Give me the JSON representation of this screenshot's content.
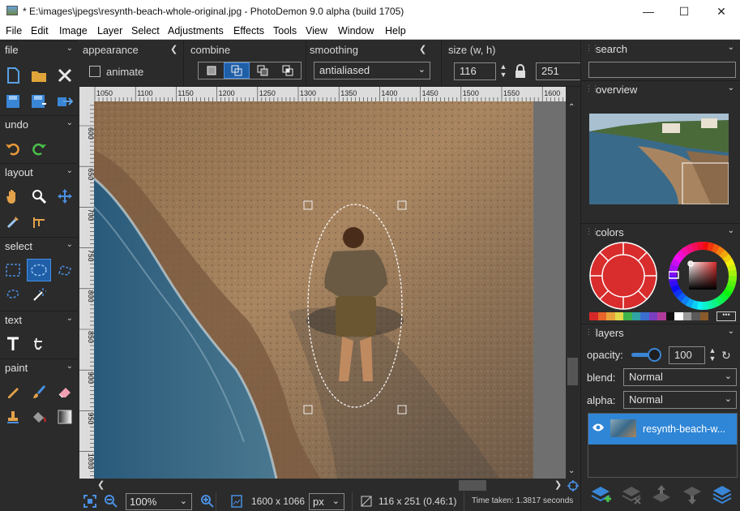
{
  "window": {
    "title": "* E:\\images\\jpegs\\resynth-beach-whole-original.jpg  -  PhotoDemon 9.0 alpha (build 1705)",
    "controls": [
      "minimize",
      "maximize",
      "close"
    ]
  },
  "menu": [
    "File",
    "Edit",
    "Image",
    "Layer",
    "Select",
    "Adjustments",
    "Effects",
    "Tools",
    "View",
    "Window",
    "Help"
  ],
  "toolbox": {
    "sections": {
      "file": "file",
      "undo": "undo",
      "layout": "layout",
      "select": "select",
      "text": "text",
      "paint": "paint"
    }
  },
  "options": {
    "appearance_label": "appearance",
    "animate_label": "animate",
    "combine_label": "combine",
    "smoothing_label": "smoothing",
    "smoothing_value": "antialiased",
    "size_label": "size (w, h)",
    "width": "116",
    "height": "251"
  },
  "rulers": {
    "horizontal": [
      "1050",
      "1100",
      "1150",
      "1200",
      "1250",
      "1300",
      "1350",
      "1400",
      "1450",
      "1500",
      "1550",
      "1600",
      "1650"
    ],
    "vertical": [
      "600",
      "650",
      "700",
      "750",
      "800",
      "850",
      "900",
      "950",
      "1000"
    ]
  },
  "status": {
    "zoom": "100%",
    "image_size": "1600 x 1066",
    "unit": "px",
    "selection_size": "116 x 251  (0.46:1)",
    "time_taken": "Time taken: 1.3817 seconds"
  },
  "panel": {
    "search_label": "search",
    "overview_label": "overview",
    "colors_label": "colors",
    "layers_label": "layers",
    "opacity_label": "opacity:",
    "opacity_value": "100",
    "blend_label": "blend:",
    "blend_value": "Normal",
    "alpha_label": "alpha:",
    "alpha_value": "Normal",
    "layer_name": "resynth-beach-w...",
    "primary_color": "#d92c2c",
    "palette": [
      "#d62828",
      "#e8642a",
      "#e9a23b",
      "#e2d84a",
      "#3db34a",
      "#2fa3a8",
      "#3a6fd0",
      "#7a3fc0",
      "#b03a9a",
      "#111111",
      "#ffffff",
      "#9a9a9a",
      "#5a5a5a",
      "#8b5a2b"
    ]
  },
  "colors": {
    "accent": "#1f5fa8",
    "selected_layer": "#2f86d6",
    "background": "#2b2b2b"
  }
}
